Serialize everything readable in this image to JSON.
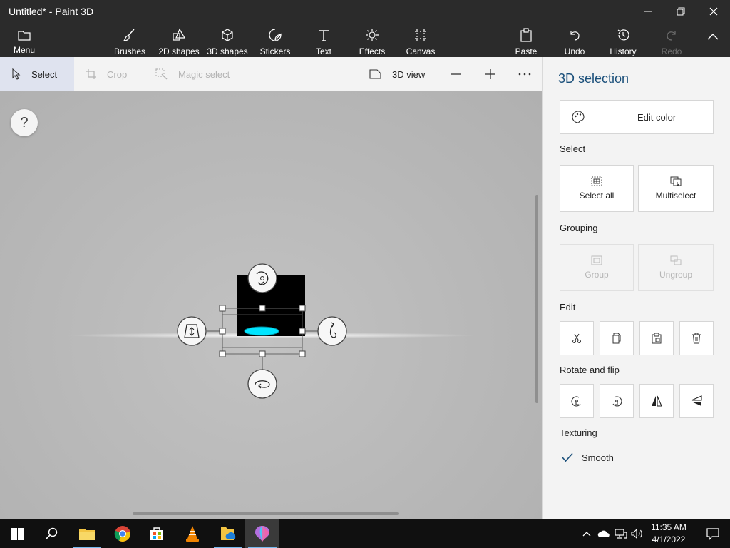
{
  "window": {
    "title": "Untitled* - Paint 3D"
  },
  "ribbon": {
    "menu": "Menu",
    "brushes": "Brushes",
    "shapes2d": "2D shapes",
    "shapes3d": "3D shapes",
    "stickers": "Stickers",
    "text": "Text",
    "effects": "Effects",
    "canvas": "Canvas",
    "paste": "Paste",
    "undo": "Undo",
    "history": "History",
    "redo": "Redo"
  },
  "toolbar": {
    "select": "Select",
    "crop": "Crop",
    "magic_select": "Magic select",
    "view3d": "3D view"
  },
  "canvas": {
    "help": "?"
  },
  "panel": {
    "title": "3D selection",
    "edit_color": "Edit color",
    "select_section": "Select",
    "select_all": "Select all",
    "multiselect": "Multiselect",
    "grouping_section": "Grouping",
    "group": "Group",
    "ungroup": "Ungroup",
    "edit_section": "Edit",
    "rotate_section": "Rotate and flip",
    "texturing_section": "Texturing",
    "smooth": "Smooth",
    "smooth_checked": true
  },
  "taskbar": {
    "time": "11:35 AM",
    "date": "4/1/2022"
  },
  "colors": {
    "accent": "#1a4f7a",
    "selection_fill": "#00e5ff",
    "object": "#000000"
  }
}
